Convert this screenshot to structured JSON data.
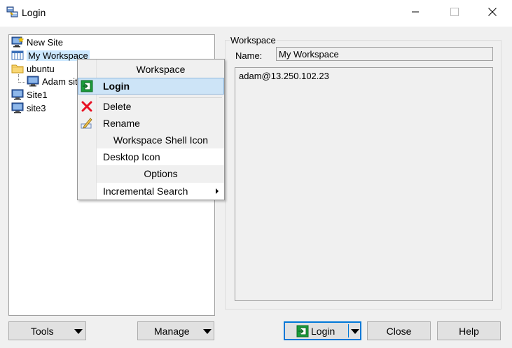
{
  "window": {
    "title": "Login",
    "app_icon": "putty-computers-icon"
  },
  "tree": {
    "items": [
      {
        "label": "New Site",
        "icon": "new-site-icon"
      },
      {
        "label": "My Workspace",
        "icon": "workspace-icon",
        "selected": true
      },
      {
        "label": "ubuntu",
        "icon": "folder-icon"
      },
      {
        "label": "Adam site",
        "icon": "computer-icon"
      },
      {
        "label": "Site1",
        "icon": "computer-icon"
      },
      {
        "label": "site3",
        "icon": "computer-icon"
      }
    ]
  },
  "context_menu": {
    "header": "Workspace",
    "items": [
      {
        "label": "Login",
        "icon": "login-icon",
        "highlighted": true
      },
      {
        "label": "Delete",
        "icon": "delete-icon"
      },
      {
        "label": "Rename",
        "icon": "rename-icon"
      },
      {
        "label": "Workspace Shell Icon"
      },
      {
        "label": "Desktop Icon"
      },
      {
        "label": "Options"
      },
      {
        "label": "Incremental Search",
        "submenu": true
      }
    ]
  },
  "workspace": {
    "legend": "Workspace",
    "name_label": "Name:",
    "name_value": "My Workspace",
    "sessions": [
      "adam@13.250.102.23"
    ]
  },
  "buttons": {
    "tools": "Tools",
    "manage": "Manage",
    "login": "Login",
    "close": "Close",
    "help": "Help"
  },
  "colors": {
    "selection": "#cce8ff",
    "menu_highlight": "#cde4f7",
    "default_button_border": "#0078d7",
    "delete_red": "#e81123",
    "login_green": "#1a9c3a"
  }
}
